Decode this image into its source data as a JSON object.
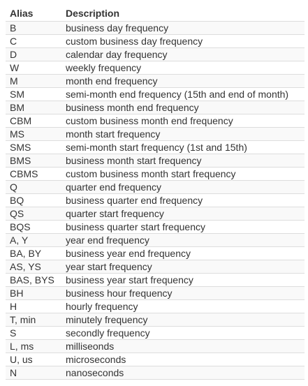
{
  "table": {
    "headers": {
      "alias": "Alias",
      "description": "Description"
    },
    "rows": [
      {
        "alias": "B",
        "description": "business day frequency"
      },
      {
        "alias": "C",
        "description": "custom business day frequency"
      },
      {
        "alias": "D",
        "description": "calendar day frequency"
      },
      {
        "alias": "W",
        "description": "weekly frequency"
      },
      {
        "alias": "M",
        "description": "month end frequency"
      },
      {
        "alias": "SM",
        "description": "semi-month end frequency (15th and end of month)"
      },
      {
        "alias": "BM",
        "description": "business month end frequency"
      },
      {
        "alias": "CBM",
        "description": "custom business month end frequency"
      },
      {
        "alias": "MS",
        "description": "month start frequency"
      },
      {
        "alias": "SMS",
        "description": "semi-month start frequency (1st and 15th)"
      },
      {
        "alias": "BMS",
        "description": "business month start frequency"
      },
      {
        "alias": "CBMS",
        "description": "custom business month start frequency"
      },
      {
        "alias": "Q",
        "description": "quarter end frequency"
      },
      {
        "alias": "BQ",
        "description": "business quarter end frequency"
      },
      {
        "alias": "QS",
        "description": "quarter start frequency"
      },
      {
        "alias": "BQS",
        "description": "business quarter start frequency"
      },
      {
        "alias": "A, Y",
        "description": "year end frequency"
      },
      {
        "alias": "BA, BY",
        "description": "business year end frequency"
      },
      {
        "alias": "AS, YS",
        "description": "year start frequency"
      },
      {
        "alias": "BAS, BYS",
        "description": "business year start frequency"
      },
      {
        "alias": "BH",
        "description": "business hour frequency"
      },
      {
        "alias": "H",
        "description": "hourly frequency"
      },
      {
        "alias": "T, min",
        "description": "minutely frequency"
      },
      {
        "alias": "S",
        "description": "secondly frequency"
      },
      {
        "alias": "L, ms",
        "description": "milliseonds"
      },
      {
        "alias": "U, us",
        "description": "microseconds"
      },
      {
        "alias": "N",
        "description": "nanoseconds"
      }
    ]
  }
}
